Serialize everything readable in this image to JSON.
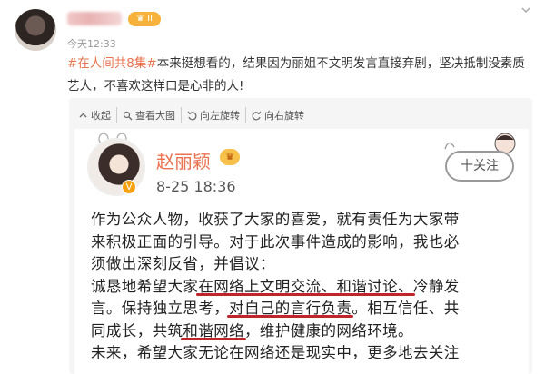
{
  "post": {
    "time": "今天12:33",
    "badge_label": "II",
    "tag": "#在人间共8集#",
    "text": "本来挺想看的，结果因为丽姐不文明发言直接弃剧，坚决抵制没素质艺人，不喜欢这样口是心非的人!",
    "more_icon": "chevron-down-icon"
  },
  "toolbar": {
    "items": [
      {
        "label": "收起",
        "icon": "collapse-icon"
      },
      {
        "label": "查看大图",
        "icon": "zoom-icon"
      },
      {
        "label": "向左旋转",
        "icon": "rotate-left-icon"
      },
      {
        "label": "向右旋转",
        "icon": "rotate-right-icon"
      }
    ]
  },
  "card": {
    "name": "赵丽颖",
    "time": "8-25 18:36",
    "follow_label": "十关注",
    "lines": [
      "作为公众人物，收获了大家的喜爱，就有责任为大家带",
      "来积极正面的引导。对于此次事件造成的影响，我也必",
      "须做出深刻反省，并倡议："
    ],
    "line4_pre": "诚恳地希望大家",
    "line4_ul": "在网络上文明交流、和谐讨论、",
    "line4_post": "冷静发",
    "line5_pre": "言。保持独立思考，",
    "line5_ul": "对自己的言行负责",
    "line5_post": "。相互信任、共",
    "line6_pre": "同成长，共筑",
    "line6_ul": "和谐网络",
    "line6_post": "，维护健康的网络环境。",
    "line7": "未来，希望大家无论在网络还是现实中，更多地去关注"
  },
  "colors": {
    "accent": "#eb7350",
    "underline": "#c0242c",
    "badge": "#f6b23a"
  }
}
